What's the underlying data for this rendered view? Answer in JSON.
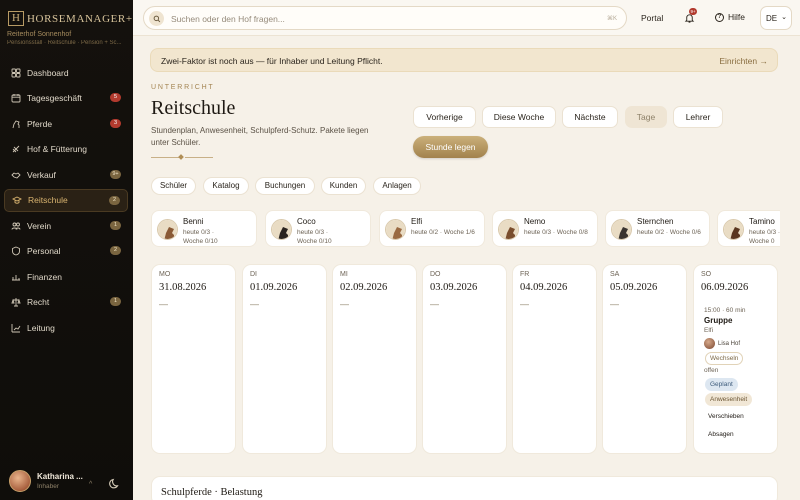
{
  "brand": {
    "logo_letter": "H",
    "name": "HORSEMANAGER+",
    "stable": "Reiterhof Sonnenhof",
    "stable_sub": "Pensionsstall · Reitschule · Pension + Sc..."
  },
  "sidebar": {
    "items": [
      {
        "label": "Dashboard",
        "icon": "grid-icon",
        "badge": ""
      },
      {
        "label": "Tagesgeschäft",
        "icon": "calendar-icon",
        "badge": "5"
      },
      {
        "label": "Pferde",
        "icon": "horse-icon",
        "badge": "3"
      },
      {
        "label": "Hof & Fütterung",
        "icon": "feed-icon",
        "badge": ""
      },
      {
        "label": "Verkauf",
        "icon": "handshake-icon",
        "badge": "9+"
      },
      {
        "label": "Reitschule",
        "icon": "school-icon",
        "badge": "2"
      },
      {
        "label": "Verein",
        "icon": "users-icon",
        "badge": "1"
      },
      {
        "label": "Personal",
        "icon": "shield-icon",
        "badge": "2"
      },
      {
        "label": "Finanzen",
        "icon": "finance-icon",
        "badge": ""
      },
      {
        "label": "Recht",
        "icon": "scale-icon",
        "badge": "1"
      },
      {
        "label": "Leitung",
        "icon": "chart-icon",
        "badge": ""
      }
    ],
    "active": "Reitschule"
  },
  "user": {
    "name": "Katharina ...",
    "role": "Inhaber"
  },
  "topbar": {
    "search_placeholder": "Suchen oder den Hof fragen...",
    "search_kbd": "⌘K",
    "portal": "Portal",
    "notif_count": "9+",
    "help": "Hilfe",
    "lang": "DE"
  },
  "banner": {
    "text": "Zwei-Faktor ist noch aus — für Inhaber und Leitung Pflicht.",
    "cta": "Einrichten →"
  },
  "page": {
    "kicker": "UNTERRICHT",
    "title": "Reitschule",
    "description": "Stundenplan, Anwesenheit, Schulpferd-Schutz. Pakete liegen unter Schüler.",
    "nav_buttons": [
      "Vorherige",
      "Diese Woche",
      "Nächste",
      "Tage",
      "Lehrer"
    ],
    "primary": "Stunde legen",
    "subtabs": [
      "Schüler",
      "Katalog",
      "Buchungen",
      "Kunden",
      "Anlagen"
    ]
  },
  "horses": [
    {
      "name": "Benni",
      "line1": "heute 0/3 ·",
      "line2": "Woche 0/10",
      "color": "#8a5a36"
    },
    {
      "name": "Coco",
      "line1": "heute 0/3 ·",
      "line2": "Woche 0/10",
      "color": "#2a2420"
    },
    {
      "name": "Elfi",
      "line1": "heute 0/2 · Woche 1/6",
      "line2": "",
      "color": "#9a6a42"
    },
    {
      "name": "Nemo",
      "line1": "heute 0/3 · Woche 0/8",
      "line2": "",
      "color": "#7a4e2e"
    },
    {
      "name": "Sternchen",
      "line1": "heute 0/2 · Woche 0/6",
      "line2": "",
      "color": "#3a3430"
    },
    {
      "name": "Tamino",
      "line1": "heute 0/3 ·",
      "line2": "Woche 0",
      "color": "#5a3620"
    }
  ],
  "days": [
    {
      "dow": "MO",
      "date": "31.08.2026",
      "empty": "—"
    },
    {
      "dow": "DI",
      "date": "01.09.2026",
      "empty": "—"
    },
    {
      "dow": "MI",
      "date": "02.09.2026",
      "empty": "—"
    },
    {
      "dow": "DO",
      "date": "03.09.2026",
      "empty": "—"
    },
    {
      "dow": "FR",
      "date": "04.09.2026",
      "empty": "—"
    },
    {
      "dow": "SA",
      "date": "05.09.2026",
      "empty": "—"
    },
    {
      "dow": "SO",
      "date": "06.09.2026",
      "empty": ""
    }
  ],
  "event": {
    "time": "15:00 · 60 min",
    "type": "Gruppe",
    "horse": "Elfi",
    "teacher": "Lisa Hof",
    "change": "Wechseln",
    "open": "offen",
    "status": "Geplant",
    "attendance": "Anwesenheit",
    "move": "Verschieben",
    "cancel": "Absagen"
  },
  "footer": {
    "title": "Schulpferde · Belastung"
  }
}
